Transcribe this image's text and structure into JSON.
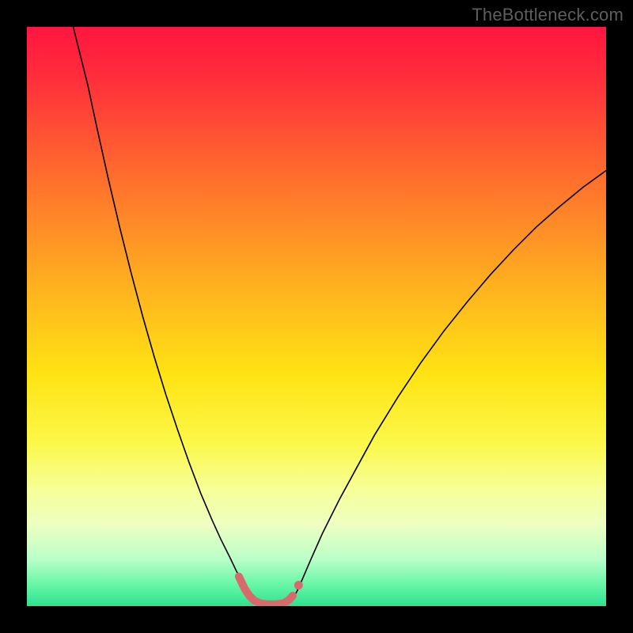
{
  "watermark": "TheBottleneck.com",
  "chart_data": {
    "type": "line",
    "title": "",
    "xlabel": "",
    "ylabel": "",
    "xlim": [
      0,
      100
    ],
    "ylim": [
      0,
      100
    ],
    "grid": false,
    "background_gradient": {
      "stops": [
        {
          "offset": 0.0,
          "color": "#ff163f"
        },
        {
          "offset": 0.08,
          "color": "#ff2b3c"
        },
        {
          "offset": 0.25,
          "color": "#ff6a2e"
        },
        {
          "offset": 0.45,
          "color": "#ffb21f"
        },
        {
          "offset": 0.6,
          "color": "#ffe313"
        },
        {
          "offset": 0.72,
          "color": "#fbf84a"
        },
        {
          "offset": 0.8,
          "color": "#f7ff99"
        },
        {
          "offset": 0.86,
          "color": "#eeffc2"
        },
        {
          "offset": 0.92,
          "color": "#b8ffc8"
        },
        {
          "offset": 0.96,
          "color": "#6cf7a9"
        },
        {
          "offset": 1.0,
          "color": "#2de28e"
        }
      ]
    },
    "series": [
      {
        "name": "bottleneck-curve",
        "stroke": "#000000",
        "stroke_width": 1.6,
        "points_xy": [
          [
            8.0,
            100.0
          ],
          [
            9.0,
            96.0
          ],
          [
            10.5,
            90.0
          ],
          [
            12.0,
            83.0
          ],
          [
            14.0,
            74.0
          ],
          [
            16.0,
            65.5
          ],
          [
            18.0,
            57.5
          ],
          [
            20.0,
            50.0
          ],
          [
            22.0,
            43.0
          ],
          [
            24.0,
            36.5
          ],
          [
            26.0,
            30.5
          ],
          [
            28.0,
            24.8
          ],
          [
            30.0,
            19.5
          ],
          [
            32.0,
            14.8
          ],
          [
            33.5,
            11.5
          ],
          [
            35.0,
            8.5
          ],
          [
            36.2,
            6.0
          ],
          [
            37.0,
            4.5
          ],
          [
            37.7,
            3.0
          ],
          [
            38.3,
            2.0
          ],
          [
            39.0,
            1.2
          ],
          [
            39.8,
            0.55
          ],
          [
            40.7,
            0.25
          ],
          [
            41.8,
            0.15
          ],
          [
            43.0,
            0.15
          ],
          [
            44.2,
            0.25
          ],
          [
            45.1,
            0.55
          ],
          [
            45.8,
            1.2
          ],
          [
            46.6,
            2.5
          ],
          [
            47.5,
            4.5
          ],
          [
            49.0,
            8.0
          ],
          [
            51.0,
            12.5
          ],
          [
            54.0,
            18.5
          ],
          [
            57.0,
            24.0
          ],
          [
            60.0,
            29.5
          ],
          [
            64.0,
            36.0
          ],
          [
            68.0,
            42.0
          ],
          [
            72.0,
            47.5
          ],
          [
            76.0,
            52.5
          ],
          [
            80.0,
            57.2
          ],
          [
            84.0,
            61.5
          ],
          [
            88.0,
            65.5
          ],
          [
            92.0,
            69.0
          ],
          [
            96.0,
            72.3
          ],
          [
            100.0,
            75.2
          ]
        ]
      },
      {
        "name": "highlight-band",
        "stroke": "#d86a6d",
        "stroke_width": 10,
        "linecap": "round",
        "points_xy": [
          [
            36.6,
            5.1
          ],
          [
            37.6,
            3.0
          ],
          [
            38.4,
            1.8
          ],
          [
            39.2,
            1.0
          ],
          [
            40.2,
            0.5
          ],
          [
            41.5,
            0.3
          ],
          [
            43.0,
            0.3
          ],
          [
            44.3,
            0.5
          ],
          [
            45.2,
            1.0
          ],
          [
            45.9,
            1.8
          ]
        ]
      }
    ],
    "markers": [
      {
        "name": "highlight-end-dot",
        "x": 46.9,
        "y": 3.6,
        "r": 5.5,
        "fill": "#d86a6d"
      }
    ]
  }
}
